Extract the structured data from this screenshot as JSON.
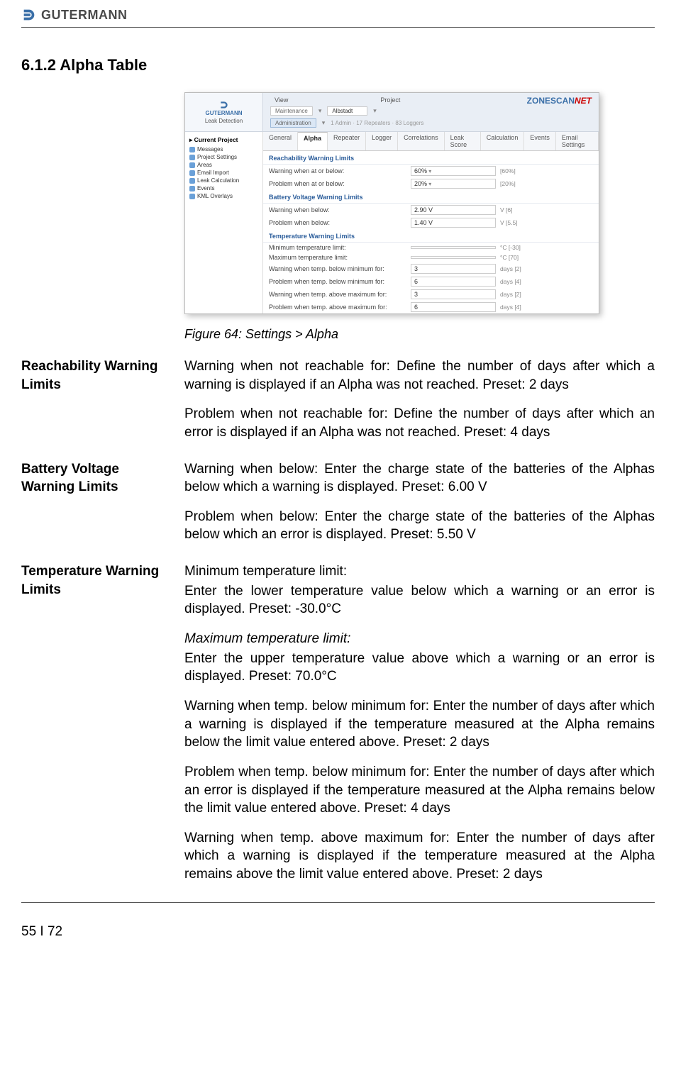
{
  "header": {
    "brand": "GUTERMANN"
  },
  "heading": "6.1.2   Alpha Table",
  "figure_caption": "Figure 64: Settings > Alpha",
  "screenshot": {
    "brand_top": "GUTERMANN",
    "brand_sub": "Leak Detection",
    "menu_view": "View",
    "menu_project": "Project",
    "btn_maintenance": "Maintenance",
    "btn_admin": "Administration",
    "project_selected": "Albstadt",
    "project_sub": "1 Admin · 17 Repeaters · 83 Loggers",
    "zonescan": "ZONESCAN",
    "net": "NET",
    "sidebar": {
      "current_project": "Current Project",
      "items": [
        "Messages",
        "Project Settings",
        "Areas",
        "Email Import",
        "Leak Calculation",
        "Events",
        "KML Overlays"
      ]
    },
    "tabs": [
      "General",
      "Alpha",
      "Repeater",
      "Logger",
      "Correlations",
      "Leak Score",
      "Calculation",
      "Events",
      "Email Settings"
    ],
    "sections": {
      "reach_title": "Reachability Warning Limits",
      "reach_rows": [
        {
          "lbl": "Warning when at or below:",
          "val": "60%",
          "unit": "[60%]",
          "dd": true
        },
        {
          "lbl": "Problem when at or below:",
          "val": "20%",
          "unit": "[20%]",
          "dd": true
        }
      ],
      "batt_title": "Battery Voltage Warning Limits",
      "batt_rows": [
        {
          "lbl": "Warning when below:",
          "val": "2.90 V",
          "unit": "V [6]"
        },
        {
          "lbl": "Problem when below:",
          "val": "1.40 V",
          "unit": "V [5.5]"
        }
      ],
      "temp_title": "Temperature Warning Limits",
      "temp_rows": [
        {
          "lbl": "Minimum temperature limit:",
          "val": "",
          "unit": "°C [-30]"
        },
        {
          "lbl": "Maximum temperature limit:",
          "val": "",
          "unit": "°C [70]"
        },
        {
          "lbl": "Warning when temp. below minimum for:",
          "val": "3",
          "unit": "days [2]"
        },
        {
          "lbl": "Problem when temp. below minimum for:",
          "val": "6",
          "unit": "days [4]"
        },
        {
          "lbl": "Warning when temp. above maximum for:",
          "val": "3",
          "unit": "days [2]"
        },
        {
          "lbl": "Problem when temp. above maximum for:",
          "val": "6",
          "unit": "days [4]"
        }
      ]
    }
  },
  "sections": [
    {
      "label": "Reachability Warning Limits",
      "paras": [
        "Warning when not reachable for: Define the number of days after which a warning is displayed if an Alpha was not reached. Preset: 2 days",
        "Problem when not reachable for: Define the number of days after which an error is displayed if an Alpha was not reached. Preset: 4 days"
      ]
    },
    {
      "label": "Battery Voltage Warning Limits",
      "paras": [
        "Warning when below: Enter the charge state of the batteries of the Alphas below which a warning is displayed. Preset: 6.00 V",
        "Problem when below: Enter the charge state of the batteries of the Alphas below which an error is displayed. Preset: 5.50 V"
      ]
    },
    {
      "label": "Temperature Warning Limits",
      "lead1": "Minimum temperature limit:",
      "body1": "Enter the lower temperature value below which a warning or an error is displayed. Preset: -30.0°C",
      "lead2": "Maximum temperature limit:",
      "body2": "Enter the upper temperature value above which a warning or an error is displayed. Preset: 70.0°C",
      "paras": [
        "Warning when temp. below minimum for: Enter the number of days after which a warning is displayed if the temperature measured at the Alpha remains below the limit value entered above. Preset: 2 days",
        "Problem when temp. below minimum for: Enter the number of days after which an error is displayed if the temperature measured at the Alpha remains below the limit value entered above. Preset: 4 days",
        "Warning when temp. above maximum for: Enter the number of days after which a warning is displayed if the temperature measured at the Alpha remains above the limit value entered above. Preset: 2 days"
      ]
    }
  ],
  "footer": "55 I 72"
}
